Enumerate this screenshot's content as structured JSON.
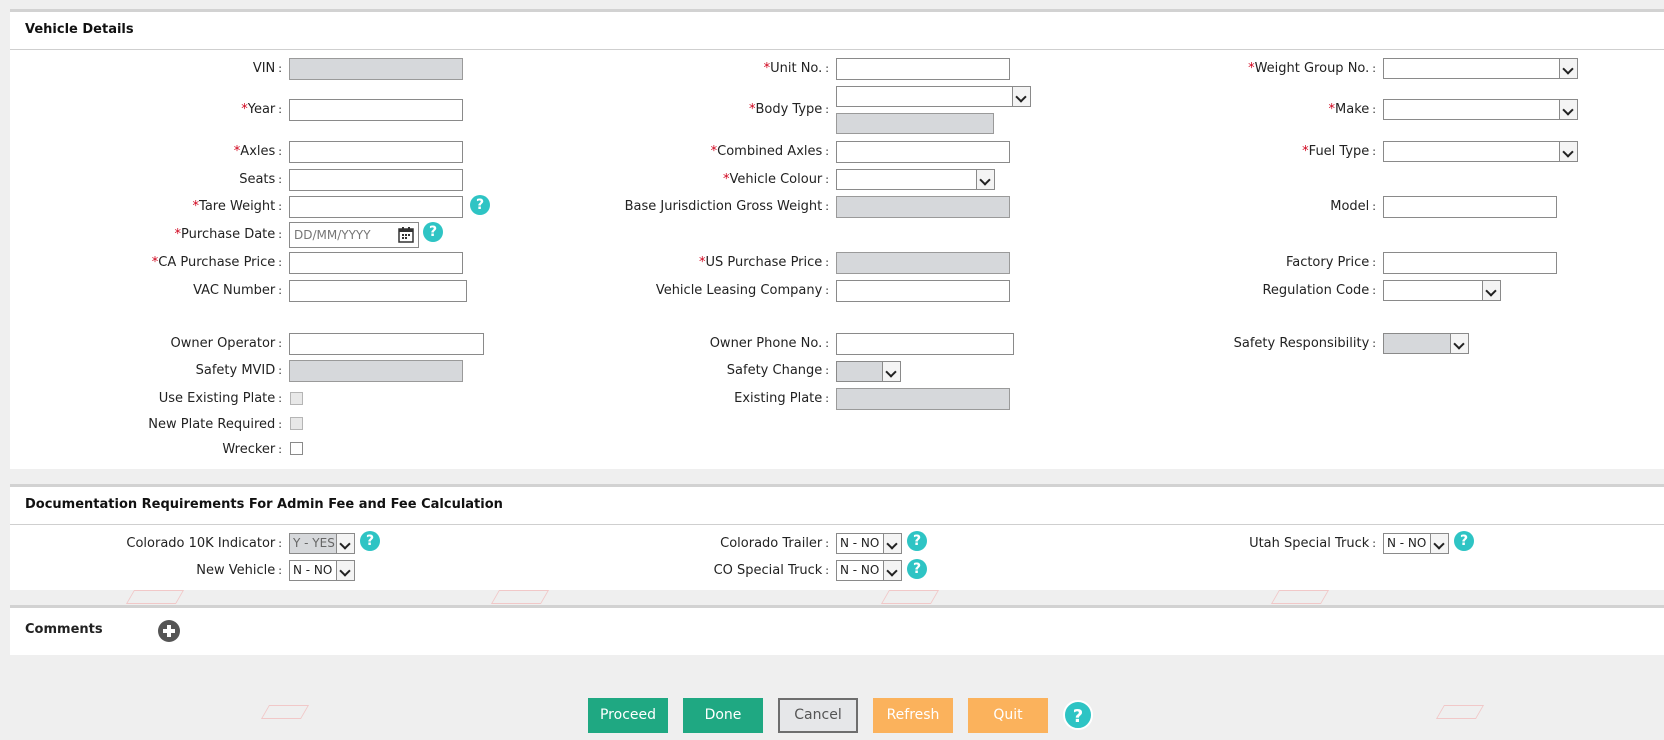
{
  "vehicle_details": {
    "title": "Vehicle Details",
    "fields": {
      "vin": "VIN",
      "unit_no": "Unit No.",
      "weight_group_no": "Weight Group No.",
      "year": "Year",
      "body_type": "Body Type",
      "make": "Make",
      "axles": "Axles",
      "combined_axles": "Combined Axles",
      "fuel_type": "Fuel Type",
      "seats": "Seats",
      "vehicle_colour": "Vehicle Colour",
      "tare_weight": "Tare Weight",
      "base_jurisdiction_gross_weight": "Base Jurisdiction Gross Weight",
      "model": "Model",
      "purchase_date": "Purchase Date",
      "purchase_date_placeholder": "DD/MM/YYYY",
      "ca_purchase_price": "CA Purchase Price",
      "us_purchase_price": "US Purchase Price",
      "factory_price": "Factory Price",
      "vac_number": "VAC Number",
      "vehicle_leasing_company": "Vehicle Leasing Company",
      "regulation_code": "Regulation Code",
      "owner_operator": "Owner Operator",
      "owner_phone_no": "Owner Phone No.",
      "safety_responsibility": "Safety Responsibility",
      "safety_mvid": "Safety MVID",
      "safety_change": "Safety Change",
      "use_existing_plate": "Use Existing Plate",
      "existing_plate": "Existing Plate",
      "new_plate_required": "New Plate Required",
      "wrecker": "Wrecker"
    },
    "required_mark": "*",
    "colon": ":"
  },
  "documentation": {
    "title": "Documentation Requirements For Admin Fee and Fee Calculation",
    "colorado_10k_indicator": {
      "label": "Colorado 10K Indicator",
      "value": "Y - YES"
    },
    "colorado_trailer": {
      "label": "Colorado Trailer",
      "value": "N - NO"
    },
    "utah_special_truck": {
      "label": "Utah Special Truck",
      "value": "N - NO"
    },
    "new_vehicle": {
      "label": "New Vehicle",
      "value": "N - NO"
    },
    "co_special_truck": {
      "label": "CO Special Truck",
      "value": "N - NO"
    }
  },
  "comments": {
    "title": "Comments"
  },
  "buttons": {
    "proceed": "Proceed",
    "done": "Done",
    "cancel": "Cancel",
    "refresh": "Refresh",
    "quit": "Quit"
  },
  "help_glyph": "?",
  "colors": {
    "help": "#2ec4c4",
    "primary_button": "#1fa882",
    "secondary_button": "#fbb25c",
    "required": "#d0021b",
    "disabled_field": "#d6d8db"
  }
}
